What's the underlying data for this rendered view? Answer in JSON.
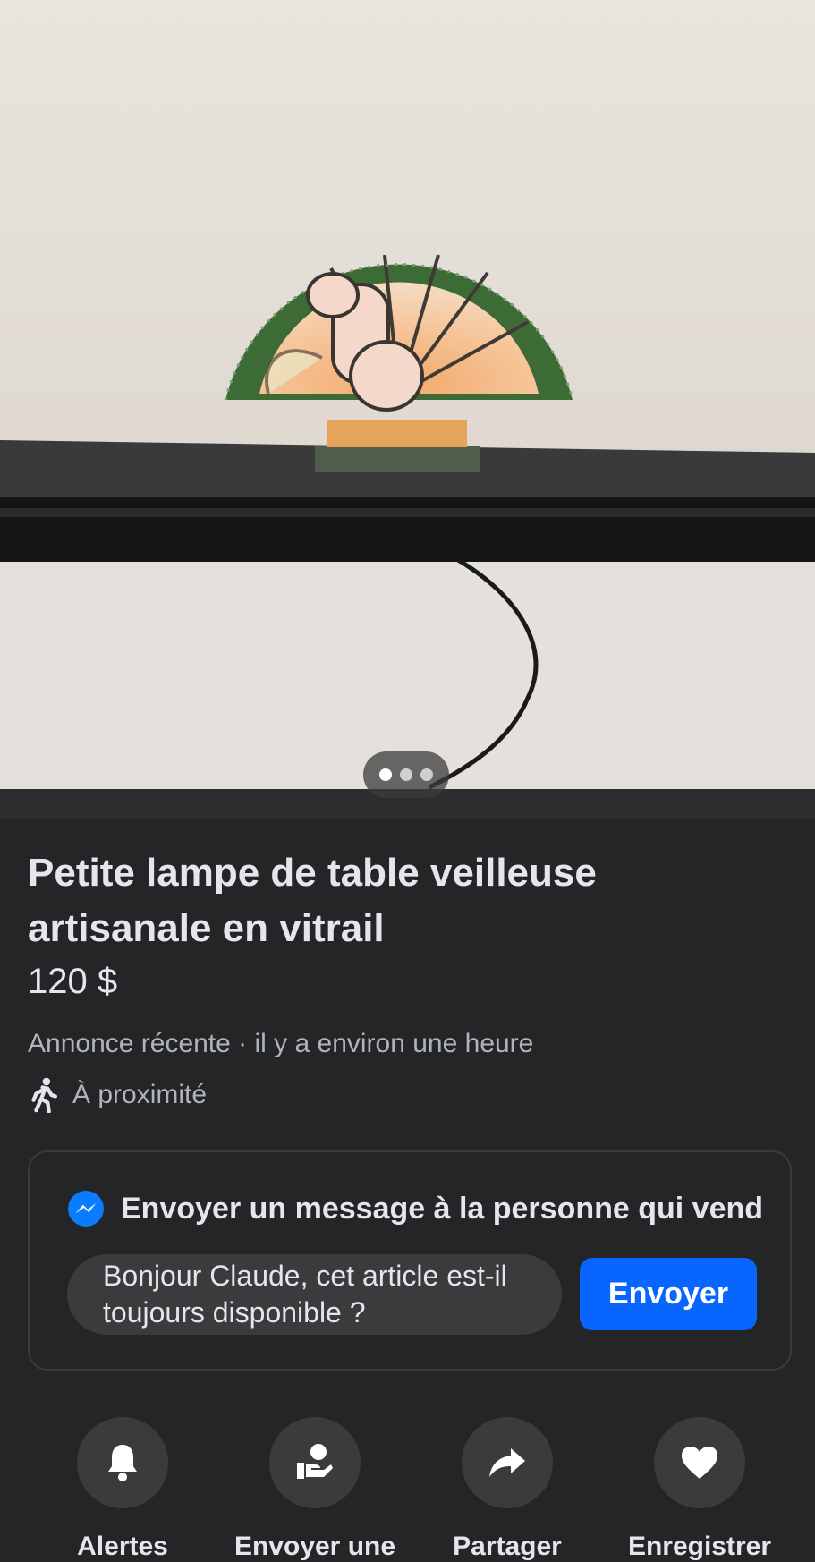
{
  "listing": {
    "title": "Petite lampe de table veilleuse artisanale  en vitrail",
    "price": "120 $",
    "meta": "Annonce récente · il y a environ une heure",
    "proximity": "À proximité"
  },
  "photo": {
    "carousel_count": 3,
    "carousel_active_index": 1
  },
  "message": {
    "heading": "Envoyer un message à la personne qui vend",
    "input_text": "Bonjour Claude, cet article est-il toujours disponible ?",
    "send_label": "Envoyer"
  },
  "actions": [
    {
      "label": "Alertes",
      "icon": "bell-icon"
    },
    {
      "label": "Envoyer une",
      "icon": "send-offer-icon"
    },
    {
      "label": "Partager",
      "icon": "share-icon"
    },
    {
      "label": "Enregistrer",
      "icon": "heart-icon"
    }
  ],
  "colors": {
    "background": "#242527",
    "card_border": "#3a3b3c",
    "primary": "#0866ff",
    "text": "#e4e6eb",
    "secondary_text": "#b0b3b8"
  }
}
